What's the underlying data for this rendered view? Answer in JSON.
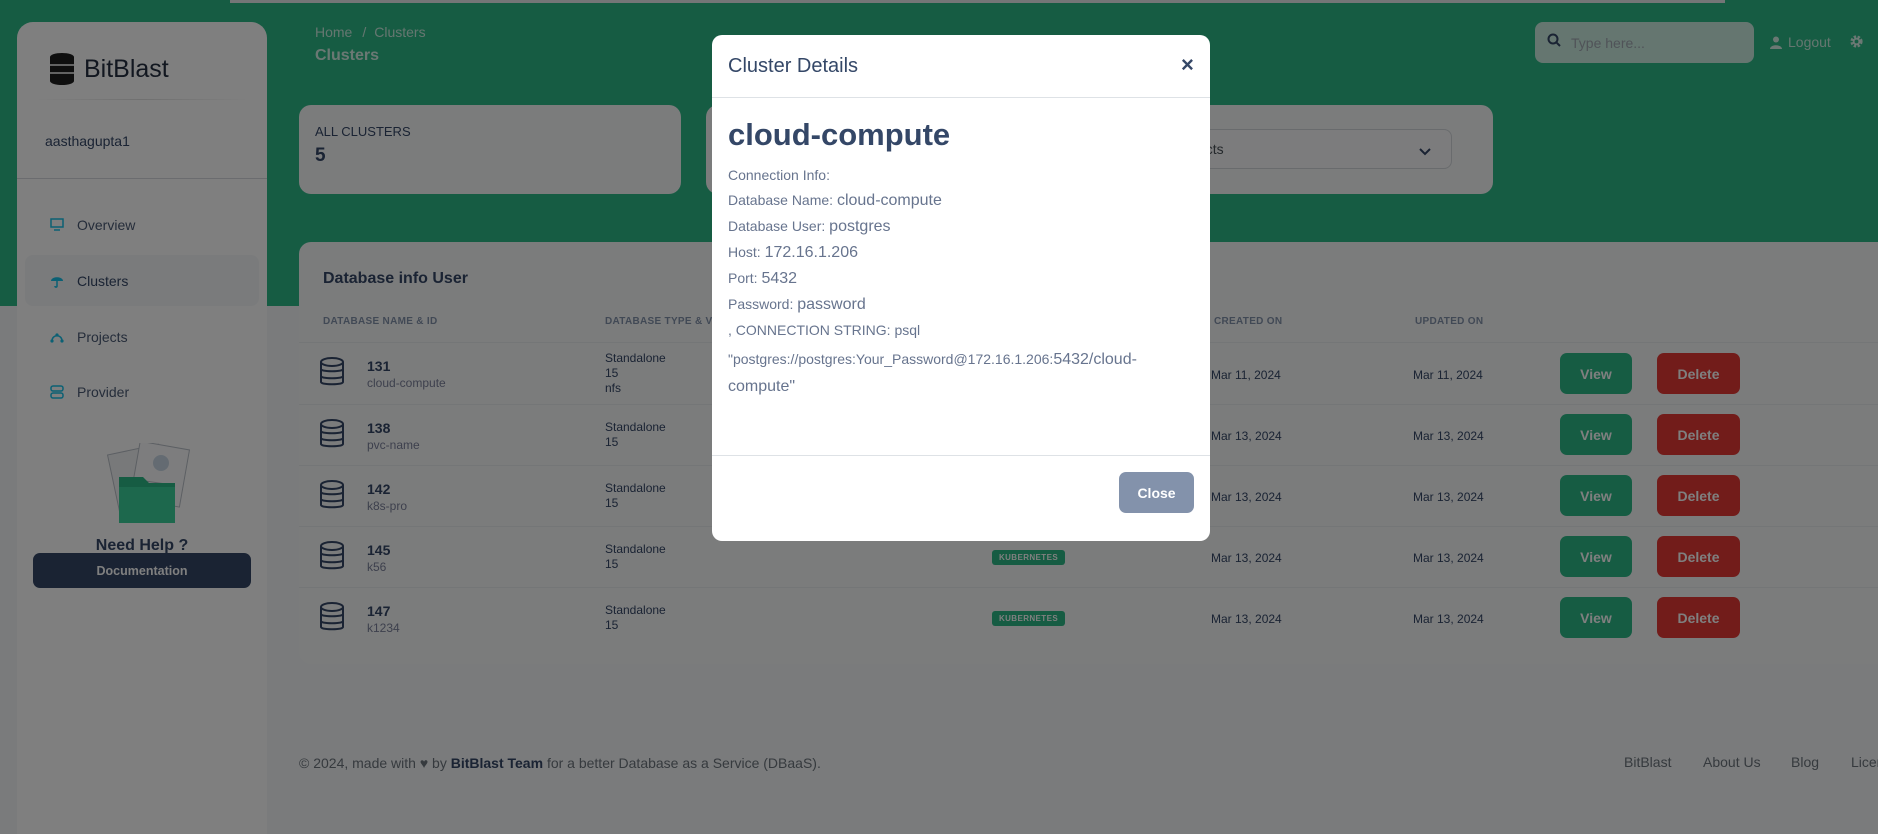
{
  "brand": {
    "name": "BitBlast"
  },
  "user": {
    "name": "aasthagupta1"
  },
  "sidebar": {
    "items": [
      {
        "label": "Overview",
        "icon": "monitor-icon"
      },
      {
        "label": "Clusters",
        "icon": "umbrella-icon"
      },
      {
        "label": "Projects",
        "icon": "projects-icon"
      },
      {
        "label": "Provider",
        "icon": "provider-icon"
      }
    ],
    "help_title": "Need Help ?",
    "doc_button": "Documentation"
  },
  "header": {
    "breadcrumb_home": "Home",
    "breadcrumb_sep": "/",
    "breadcrumb_current": "Clusters",
    "page_title": "Clusters",
    "search_placeholder": "Type here...",
    "logout": "Logout"
  },
  "stats": {
    "all_clusters_label": "ALL CLUSTERS",
    "all_clusters_value": "5",
    "filter_selected": "ects"
  },
  "table": {
    "title": "Database info User",
    "headers": [
      "DATABASE NAME & ID",
      "DATABASE TYPE & VE",
      "CREATED ON",
      "UPDATED ON"
    ],
    "rows": [
      {
        "id": "131",
        "name": "cloud-compute",
        "type": "Standalone",
        "version": "15",
        "storage": "nfs",
        "badge": "",
        "created": "Mar 11, 2024",
        "updated": "Mar 11, 2024"
      },
      {
        "id": "138",
        "name": "pvc-name",
        "type": "Standalone",
        "version": "15",
        "storage": "",
        "badge": "",
        "created": "Mar 13, 2024",
        "updated": "Mar 13, 2024"
      },
      {
        "id": "142",
        "name": "k8s-pro",
        "type": "Standalone",
        "version": "15",
        "storage": "",
        "badge": "",
        "created": "Mar 13, 2024",
        "updated": "Mar 13, 2024"
      },
      {
        "id": "145",
        "name": "k56",
        "type": "Standalone",
        "version": "15",
        "storage": "",
        "badge": "KUBERNETES",
        "created": "Mar 13, 2024",
        "updated": "Mar 13, 2024"
      },
      {
        "id": "147",
        "name": "k1234",
        "type": "Standalone",
        "version": "15",
        "storage": "",
        "badge": "KUBERNETES",
        "created": "Mar 13, 2024",
        "updated": "Mar 13, 2024"
      }
    ],
    "view_label": "View",
    "delete_label": "Delete"
  },
  "footer": {
    "prefix": "© 2024, made with",
    "by": "by",
    "team": "BitBlast Team",
    "suffix": "for a better Database as a Service (DBaaS).",
    "links": [
      "BitBlast",
      "About Us",
      "Blog",
      "Licen"
    ]
  },
  "modal": {
    "title": "Cluster Details",
    "close_x": "×",
    "cluster_name": "cloud-compute",
    "connection_info_label": "Connection Info:",
    "db_name_label": "Database Name:",
    "db_name_value": "cloud-compute",
    "db_user_label": "Database User:",
    "db_user_value": "postgres",
    "host_label": "Host:",
    "host_value": "172.16.1.206",
    "port_label": "Port:",
    "port_value": "5432",
    "password_label": "Password:",
    "password_value": "password",
    "conn_string_label": ", CONNECTION STRING:",
    "conn_string_cmd": "psql",
    "conn_string_prefix": "\"postgres://postgres:Your_Password@172.16.1.206:",
    "conn_string_suffix": "5432/cloud-compute\"",
    "close_button": "Close"
  },
  "colors": {
    "primary": "#2db887",
    "danger": "#e53935",
    "dark": "#344767",
    "secondary": "#8392ab"
  }
}
